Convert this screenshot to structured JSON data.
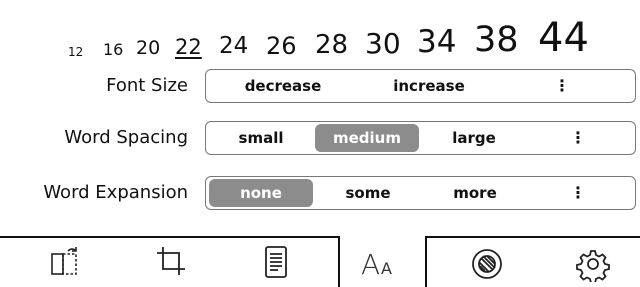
{
  "font_scale": {
    "sizes": [
      "12",
      "16",
      "20",
      "22",
      "24",
      "26",
      "28",
      "30",
      "34",
      "38",
      "44"
    ],
    "current": "22"
  },
  "font_size": {
    "label": "Font Size",
    "options": [
      "decrease",
      "increase"
    ],
    "more": "⋮"
  },
  "word_spacing": {
    "label": "Word Spacing",
    "options": [
      "small",
      "medium",
      "large"
    ],
    "selected": "medium",
    "more": "⋮"
  },
  "word_expansion": {
    "label": "Word Expansion",
    "options": [
      "none",
      "some",
      "more"
    ],
    "selected": "none",
    "more": "⋮"
  },
  "toolbar": {
    "items": [
      {
        "name": "page-rotate-icon"
      },
      {
        "name": "crop-icon"
      },
      {
        "name": "document-icon"
      },
      {
        "name": "font-settings-icon",
        "active": true
      },
      {
        "name": "contrast-icon"
      },
      {
        "name": "settings-gear-icon"
      }
    ],
    "font_icon": {
      "big": "A",
      "small": "A"
    }
  },
  "colors": {
    "selected_bg": "#8c8c8c",
    "selected_text": "#ffffff",
    "border": "#777777"
  }
}
